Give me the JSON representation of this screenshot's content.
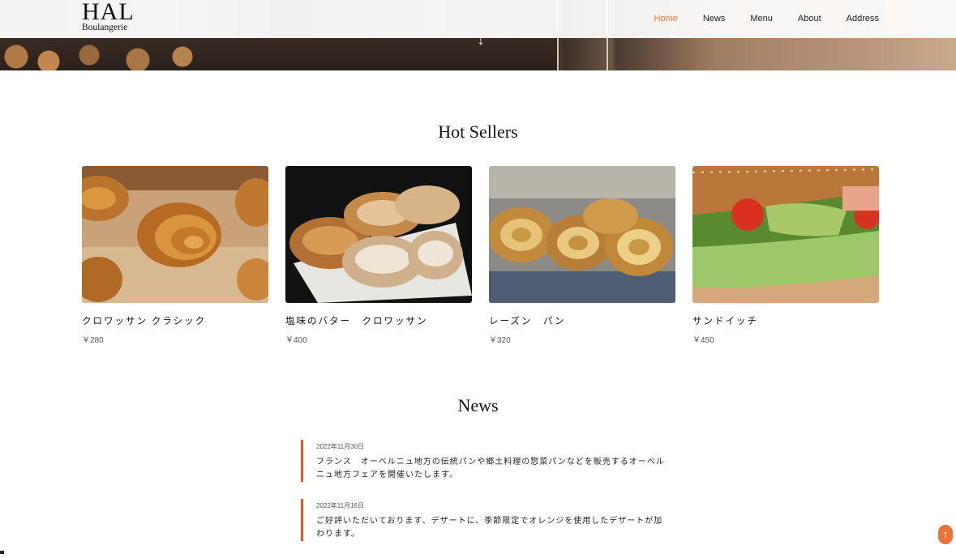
{
  "header": {
    "logo_main": "HAL",
    "logo_sub": "Boulangerie",
    "nav": [
      {
        "label": "Home",
        "active": true
      },
      {
        "label": "News"
      },
      {
        "label": "Menu"
      },
      {
        "label": "About"
      },
      {
        "label": "Address"
      }
    ]
  },
  "hero": {
    "icon": "arrow-down-icon"
  },
  "hot_sellers": {
    "title": "Hot Sellers",
    "items": [
      {
        "name": "クロワッサン クラシック",
        "price": "￥280",
        "image": "croissant-classic-photo"
      },
      {
        "name": "塩味のバター　クロワッサン",
        "price": "￥400",
        "image": "salted-butter-croissant-photo"
      },
      {
        "name": "レーズン　パン",
        "price": "￥320",
        "image": "raisin-bread-photo"
      },
      {
        "name": "サンドイッチ",
        "price": "￥450",
        "image": "sandwich-photo"
      }
    ]
  },
  "news": {
    "title": "News",
    "items": [
      {
        "date": "2022年11月30日",
        "text": "フランス　オーベルニュ地方の伝統パンや郷土料理の惣菜パンなどを販売するオーベルニュ地方フェアを開催いたします。"
      },
      {
        "date": "2022年11月16日",
        "text": "ご好評いただいております、デザートに、季節限定でオレンジを使用したデザートが加わります。"
      }
    ]
  },
  "back_to_top": {
    "icon": "arrow-up-icon"
  },
  "colors": {
    "accent": "#e8743b",
    "news_bar": "#e0582a"
  }
}
